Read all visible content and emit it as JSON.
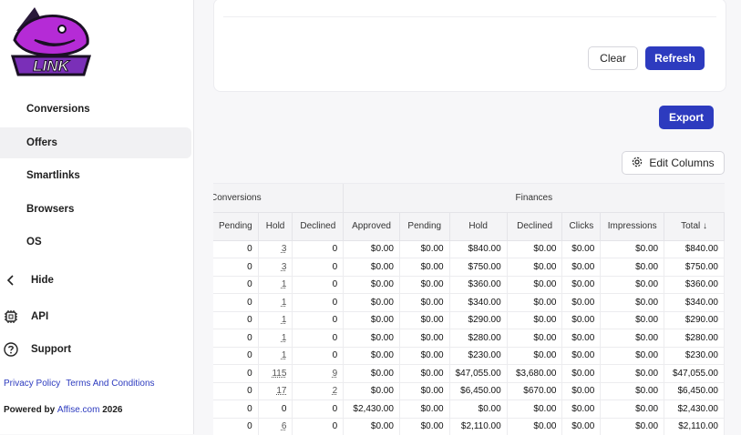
{
  "brand": {
    "logo_text": "LINK",
    "accent": "#2d3bbf",
    "logo_purple": "#a020c8"
  },
  "sidebar": {
    "items": [
      {
        "label": "Conversions",
        "active": false
      },
      {
        "label": "Offers",
        "active": true
      },
      {
        "label": "Smartlinks",
        "active": false
      },
      {
        "label": "Browsers",
        "active": false
      },
      {
        "label": "OS",
        "active": false
      }
    ],
    "hide_label": "Hide",
    "api_label": "API",
    "support_label": "Support",
    "privacy_label": "Privacy Policy",
    "terms_label": "Terms And Conditions",
    "powered_prefix": "Powered by",
    "powered_brand": "Affise.com",
    "powered_year": "2026"
  },
  "filters": {
    "clear_label": "Clear",
    "refresh_label": "Refresh"
  },
  "toolbar": {
    "export_label": "Export",
    "edit_columns_label": "Edit Columns"
  },
  "table": {
    "group_headers": {
      "conversions": "Conversions",
      "finances": "Finances"
    },
    "columns": [
      "Pending",
      "Hold",
      "Declined",
      "Approved",
      "Pending",
      "Hold",
      "Declined",
      "Clicks",
      "Impressions",
      "Total"
    ],
    "sort_indicator": "↓",
    "rows": [
      [
        "0",
        "3",
        "0",
        "$0.00",
        "$0.00",
        "$840.00",
        "$0.00",
        "$0.00",
        "$0.00",
        "$840.00"
      ],
      [
        "0",
        "3",
        "0",
        "$0.00",
        "$0.00",
        "$750.00",
        "$0.00",
        "$0.00",
        "$0.00",
        "$750.00"
      ],
      [
        "0",
        "1",
        "0",
        "$0.00",
        "$0.00",
        "$360.00",
        "$0.00",
        "$0.00",
        "$0.00",
        "$360.00"
      ],
      [
        "0",
        "1",
        "0",
        "$0.00",
        "$0.00",
        "$340.00",
        "$0.00",
        "$0.00",
        "$0.00",
        "$340.00"
      ],
      [
        "0",
        "1",
        "0",
        "$0.00",
        "$0.00",
        "$290.00",
        "$0.00",
        "$0.00",
        "$0.00",
        "$290.00"
      ],
      [
        "0",
        "1",
        "0",
        "$0.00",
        "$0.00",
        "$280.00",
        "$0.00",
        "$0.00",
        "$0.00",
        "$280.00"
      ],
      [
        "0",
        "1",
        "0",
        "$0.00",
        "$0.00",
        "$230.00",
        "$0.00",
        "$0.00",
        "$0.00",
        "$230.00"
      ],
      [
        "0",
        "115",
        "9",
        "$0.00",
        "$0.00",
        "$47,055.00",
        "$3,680.00",
        "$0.00",
        "$0.00",
        "$47,055.00"
      ],
      [
        "0",
        "17",
        "2",
        "$0.00",
        "$0.00",
        "$6,450.00",
        "$670.00",
        "$0.00",
        "$0.00",
        "$6,450.00"
      ],
      [
        "0",
        "0",
        "0",
        "$2,430.00",
        "$0.00",
        "$0.00",
        "$0.00",
        "$0.00",
        "$0.00",
        "$2,430.00"
      ],
      [
        "0",
        "6",
        "0",
        "$0.00",
        "$0.00",
        "$2,110.00",
        "$0.00",
        "$0.00",
        "$0.00",
        "$2,110.00"
      ]
    ]
  }
}
